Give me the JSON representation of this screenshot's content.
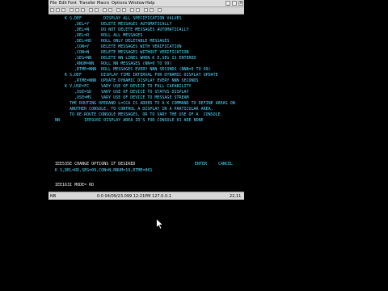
{
  "menubar": {
    "items": [
      "File",
      "Edit",
      "Font",
      "Transfer",
      "Macro",
      "Options",
      "Window",
      "Help"
    ]
  },
  "terminal": {
    "lines": [
      "K S,DEF         DISPLAY ALL SPECIFICATION VALUES",
      "    ,DEL=Y     DELETE MESSAGES AUTOMATICALLY",
      "    ,DEL=N     DO NOT DELETE MESSAGES AUTOMATICALLY",
      "    ,DEL=R     ROLL ALL MESSAGES",
      "    ,DEL=RD    ROLL ONLY DELETABLE MESSAGES",
      "    ,CON=Y     DELETE MESSAGES WITH VERIFICATION",
      "    ,CON=N     DELETE MESSAGES WITHOUT VERIFICATION",
      "    ,SEG=NN    DELETE NN LINES WHEN K E,SEG IS ENTERED",
      "    ,RNUM=NN   ROLL NN MESSAGES (NN=0 TO 99)",
      "    ,RTME=NNN  ROLL MESSAGES EVERY NNN SECONDS (NNN=0 TO 99)",
      "K S,DEF        DISPLAY TIME INTERVAL FOR DYNAMIC DISPLAY UPDATE",
      "    ,RTME=NNN  UPDATE DYNAMIC DISPLAY EVERY NNN SECONDS",
      "K V,USE=FC     VARY USE OF DEVICE TO FULL CAPABILITY",
      "    ,USE=SD    VARY USE OF DEVICE TO STATUS DISPLAY",
      "    ,USE=MS    VARY USE OF DEVICE TO MESSAGE STREAM",
      "  THE ROUTING OPERAND L=CCA IS ADDED TO A K COMMAND TO DEFINE AREAS ON",
      "  ANOTHER CONSOLE, TO CONTROL A DISPLAY IN A PARTICULAR AREA,",
      "  TO RE-ROUTE CONSOLE MESSAGES, OR TO VARY THE USE OF A  CONSOLE.",
      "NN          IEE920I DISPLAY AREA ID'S FOR CONSOLE 01 ARE NONE"
    ],
    "prompt_line": "IEE535E CHANGE OPTIONS IF DESIRED",
    "enter_label": "ENTER",
    "cancel_label": "CANCEL",
    "command_input": "K S,DEL=RD,SEG=09,CON=N,RNUM=19,RTME=001",
    "mode_line": "IEE163I MODE= RD"
  },
  "statusbar": {
    "left": "NB",
    "info": "0.0 04/09/23.099 12:21PM 127.0.0.1",
    "position": "22,11"
  }
}
